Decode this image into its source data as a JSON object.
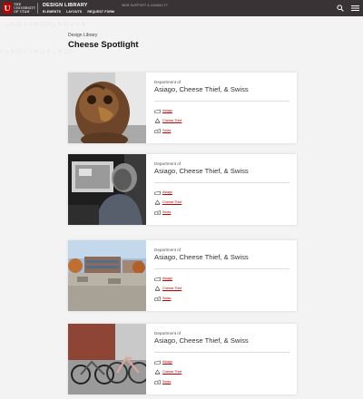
{
  "header": {
    "logo_text": "THE UNIVERSITY OF UTAH",
    "brand_title": "DESIGN LIBRARY",
    "subtitle": "WEB SUPPORT & USABILITY",
    "nav": [
      "ELEMENTS",
      "LAYOUTS",
      "REQUEST FORM"
    ]
  },
  "page": {
    "breadcrumb": "Design Library",
    "title": "Cheese Spotlight"
  },
  "cards": [
    {
      "dept": "Department of",
      "name": "Asiago, Cheese Thief, & Swiss",
      "links": [
        {
          "label": "Asiago"
        },
        {
          "label": "Cheese Thief"
        },
        {
          "label": "Swiss"
        }
      ]
    },
    {
      "dept": "Department of",
      "name": "Asiago, Cheese Thief, & Swiss",
      "links": [
        {
          "label": "Asiago"
        },
        {
          "label": "Cheese Thief"
        },
        {
          "label": "Swiss"
        }
      ]
    },
    {
      "dept": "Department of",
      "name": "Asiago, Cheese Thief, & Swiss",
      "links": [
        {
          "label": "Asiago"
        },
        {
          "label": "Cheese Thief"
        },
        {
          "label": "Swiss"
        }
      ]
    },
    {
      "dept": "Department of",
      "name": "Asiago, Cheese Thief, & Swiss",
      "links": [
        {
          "label": "Asiago"
        },
        {
          "label": "Cheese Thief"
        },
        {
          "label": "Swiss"
        }
      ]
    }
  ],
  "icons": {
    "search": "search-icon",
    "menu": "hamburger-menu-icon",
    "cheese": "cheese-icon",
    "thief": "cheese-thief-icon",
    "mouse": "mouse-icon"
  },
  "colors": {
    "topbar": "#3a3336",
    "brand_red": "#be0000",
    "link": "#be0000"
  }
}
